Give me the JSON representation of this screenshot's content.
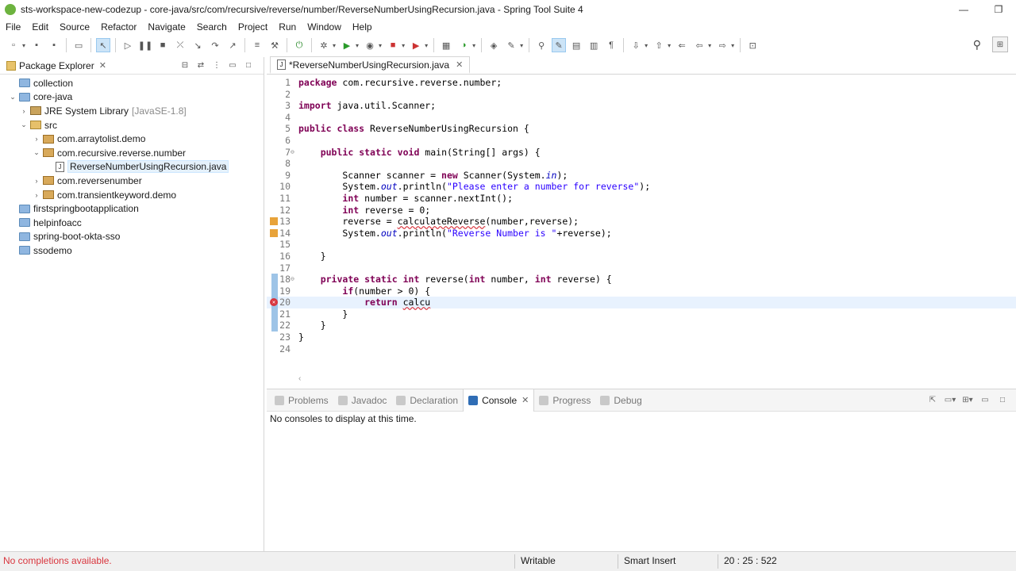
{
  "window": {
    "title": "sts-workspace-new-codezup - core-java/src/com/recursive/reverse/number/ReverseNumberUsingRecursion.java - Spring Tool Suite 4",
    "minimize": "—",
    "restore": "❐"
  },
  "menu": [
    "File",
    "Edit",
    "Source",
    "Refactor",
    "Navigate",
    "Search",
    "Project",
    "Run",
    "Window",
    "Help"
  ],
  "package_explorer": {
    "title": "Package Explorer",
    "items": [
      {
        "label": "collection",
        "extra": ""
      },
      {
        "label": "core-java",
        "extra": ""
      },
      {
        "label": "JRE System Library",
        "extra": "[JavaSE-1.8]"
      },
      {
        "label": "src",
        "extra": ""
      },
      {
        "label": "com.arraytolist.demo",
        "extra": ""
      },
      {
        "label": "com.recursive.reverse.number",
        "extra": ""
      },
      {
        "label": "ReverseNumberUsingRecursion.java",
        "extra": ""
      },
      {
        "label": "com.reversenumber",
        "extra": ""
      },
      {
        "label": "com.transientkeyword.demo",
        "extra": ""
      },
      {
        "label": "firstspringbootapplication",
        "extra": ""
      },
      {
        "label": "helpinfoacc",
        "extra": ""
      },
      {
        "label": "spring-boot-okta-sso",
        "extra": ""
      },
      {
        "label": "ssodemo",
        "extra": ""
      }
    ]
  },
  "editor": {
    "tab_label": "*ReverseNumberUsingRecursion.java",
    "lines": [
      {
        "n": "1",
        "code": "package com.recursive.reverse.number;"
      },
      {
        "n": "2",
        "code": ""
      },
      {
        "n": "3",
        "code": "import java.util.Scanner;"
      },
      {
        "n": "4",
        "code": ""
      },
      {
        "n": "5",
        "code": "public class ReverseNumberUsingRecursion {"
      },
      {
        "n": "6",
        "code": ""
      },
      {
        "n": "7",
        "code": "    public static void main(String[] args) {"
      },
      {
        "n": "8",
        "code": ""
      },
      {
        "n": "9",
        "code": "        Scanner scanner = new Scanner(System.in);"
      },
      {
        "n": "10",
        "code": "        System.out.println(\"Please enter a number for reverse\");"
      },
      {
        "n": "11",
        "code": "        int number = scanner.nextInt();"
      },
      {
        "n": "12",
        "code": "        int reverse = 0;"
      },
      {
        "n": "13",
        "code": "        reverse = calculateReverse(number,reverse);"
      },
      {
        "n": "14",
        "code": "        System.out.println(\"Reverse Number is \"+reverse);"
      },
      {
        "n": "15",
        "code": ""
      },
      {
        "n": "16",
        "code": "    }"
      },
      {
        "n": "17",
        "code": ""
      },
      {
        "n": "18",
        "code": "    private static int reverse(int number, int reverse) {"
      },
      {
        "n": "19",
        "code": "        if(number > 0) {"
      },
      {
        "n": "20",
        "code": "            return calcu"
      },
      {
        "n": "21",
        "code": "        }"
      },
      {
        "n": "22",
        "code": "    }"
      },
      {
        "n": "23",
        "code": "}"
      },
      {
        "n": "24",
        "code": ""
      }
    ]
  },
  "bottom": {
    "tabs": [
      "Problems",
      "Javadoc",
      "Declaration",
      "Console",
      "Progress",
      "Debug"
    ],
    "active_tab": "Console",
    "console_message": "No consoles to display at this time."
  },
  "status": {
    "message": "No completions available.",
    "writable": "Writable",
    "insert_mode": "Smart Insert",
    "position": "20 : 25 : 522"
  }
}
